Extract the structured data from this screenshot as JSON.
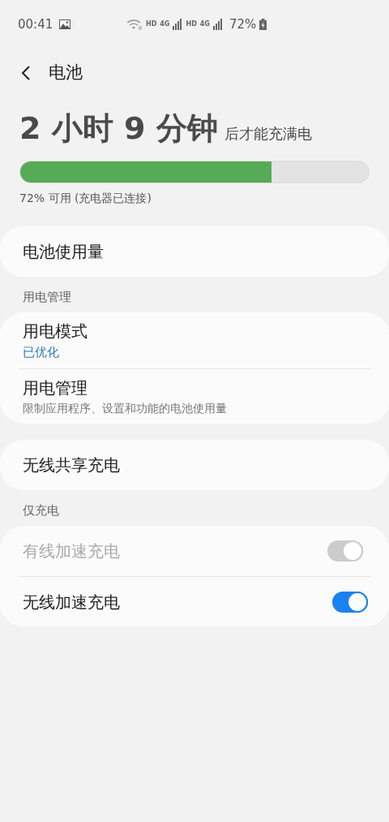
{
  "status_bar": {
    "time": "00:41",
    "network": [
      {
        "label": "HD",
        "type": "4G"
      },
      {
        "label": "HD",
        "type": "4G"
      }
    ],
    "battery": "72%"
  },
  "header": {
    "title": "电池"
  },
  "charge": {
    "remaining": "2 小时 9 分钟",
    "suffix": "后才能充满电",
    "level": 0.72,
    "status": "72% 可用 (充电器已连接)"
  },
  "groups": [
    {
      "items": [
        {
          "kind": "plain",
          "title": "电池使用量"
        }
      ]
    },
    {
      "header": "用电管理",
      "items": [
        {
          "kind": "value",
          "title": "用电模式",
          "subtitle": "已优化"
        },
        {
          "kind": "description",
          "title": "用电管理",
          "subtitle": "限制应用程序、设置和功能的电池使用量"
        }
      ]
    },
    {
      "items": [
        {
          "kind": "plain",
          "title": "无线共享充电"
        }
      ]
    },
    {
      "header": "仅充电",
      "items": [
        {
          "kind": "toggle",
          "title": "有线加速充电",
          "on": true,
          "disabled": true
        },
        {
          "kind": "toggle",
          "title": "无线加速充电",
          "on": true,
          "disabled": false
        }
      ]
    }
  ]
}
